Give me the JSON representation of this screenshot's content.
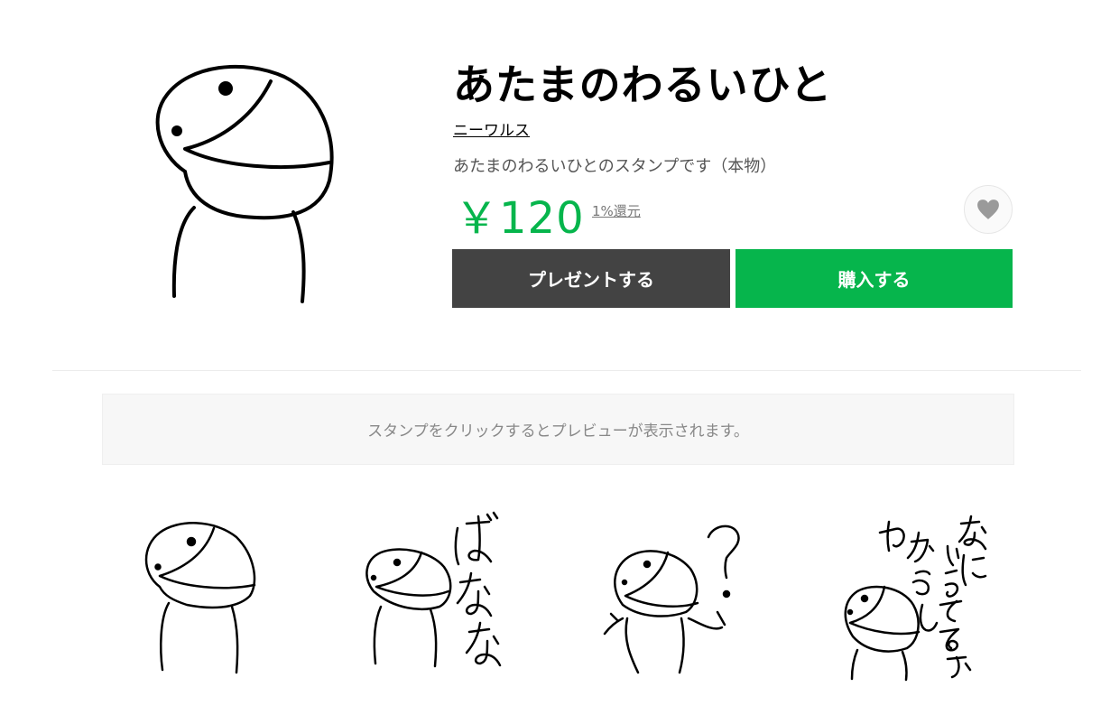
{
  "product": {
    "title": "あたまのわるいひと",
    "author": "ニーワルス",
    "description": "あたまのわるいひとのスタンプです（本物）",
    "price": "￥120",
    "points": "1%還元"
  },
  "buttons": {
    "gift_label": "プレゼントする",
    "buy_label": "購入する"
  },
  "notice": "スタンプをクリックするとプレビューが表示されます。",
  "stamps": [
    {
      "text": ""
    },
    {
      "text": "ばなな"
    },
    {
      "text": "?"
    },
    {
      "text": "なにいうてるかわからん"
    }
  ],
  "icons": {
    "favorite": "heart-icon"
  },
  "colors": {
    "accent": "#06b54c",
    "gift_button": "#434343",
    "favorite_icon": "#9a9a9a"
  }
}
